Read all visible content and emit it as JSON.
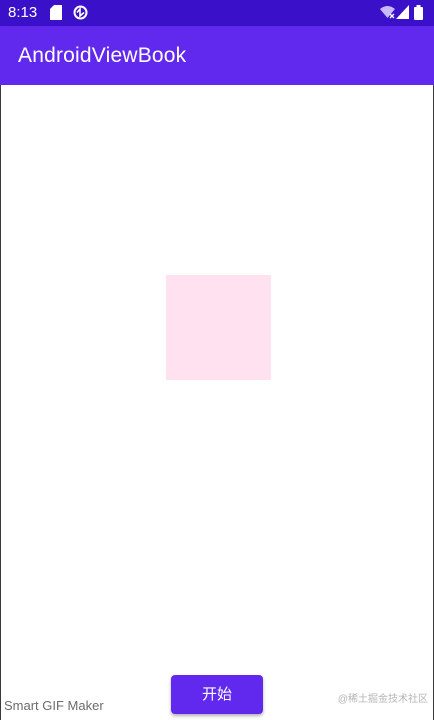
{
  "status_bar": {
    "time": "8:13",
    "left_icons": [
      "sd-card-icon",
      "data-saver-icon"
    ],
    "right_icons": [
      "wifi-icon",
      "signal-icon",
      "battery-icon"
    ]
  },
  "app_bar": {
    "title": "AndroidViewBook"
  },
  "main": {
    "square_color": "#ffe1f0",
    "start_button_label": "开始"
  },
  "watermarks": {
    "left": "Smart GIF Maker",
    "right": "@稀土掘金技术社区"
  },
  "colors": {
    "status_bar": "#3a10c9",
    "app_bar": "#6128ee",
    "button": "#6128ee"
  }
}
